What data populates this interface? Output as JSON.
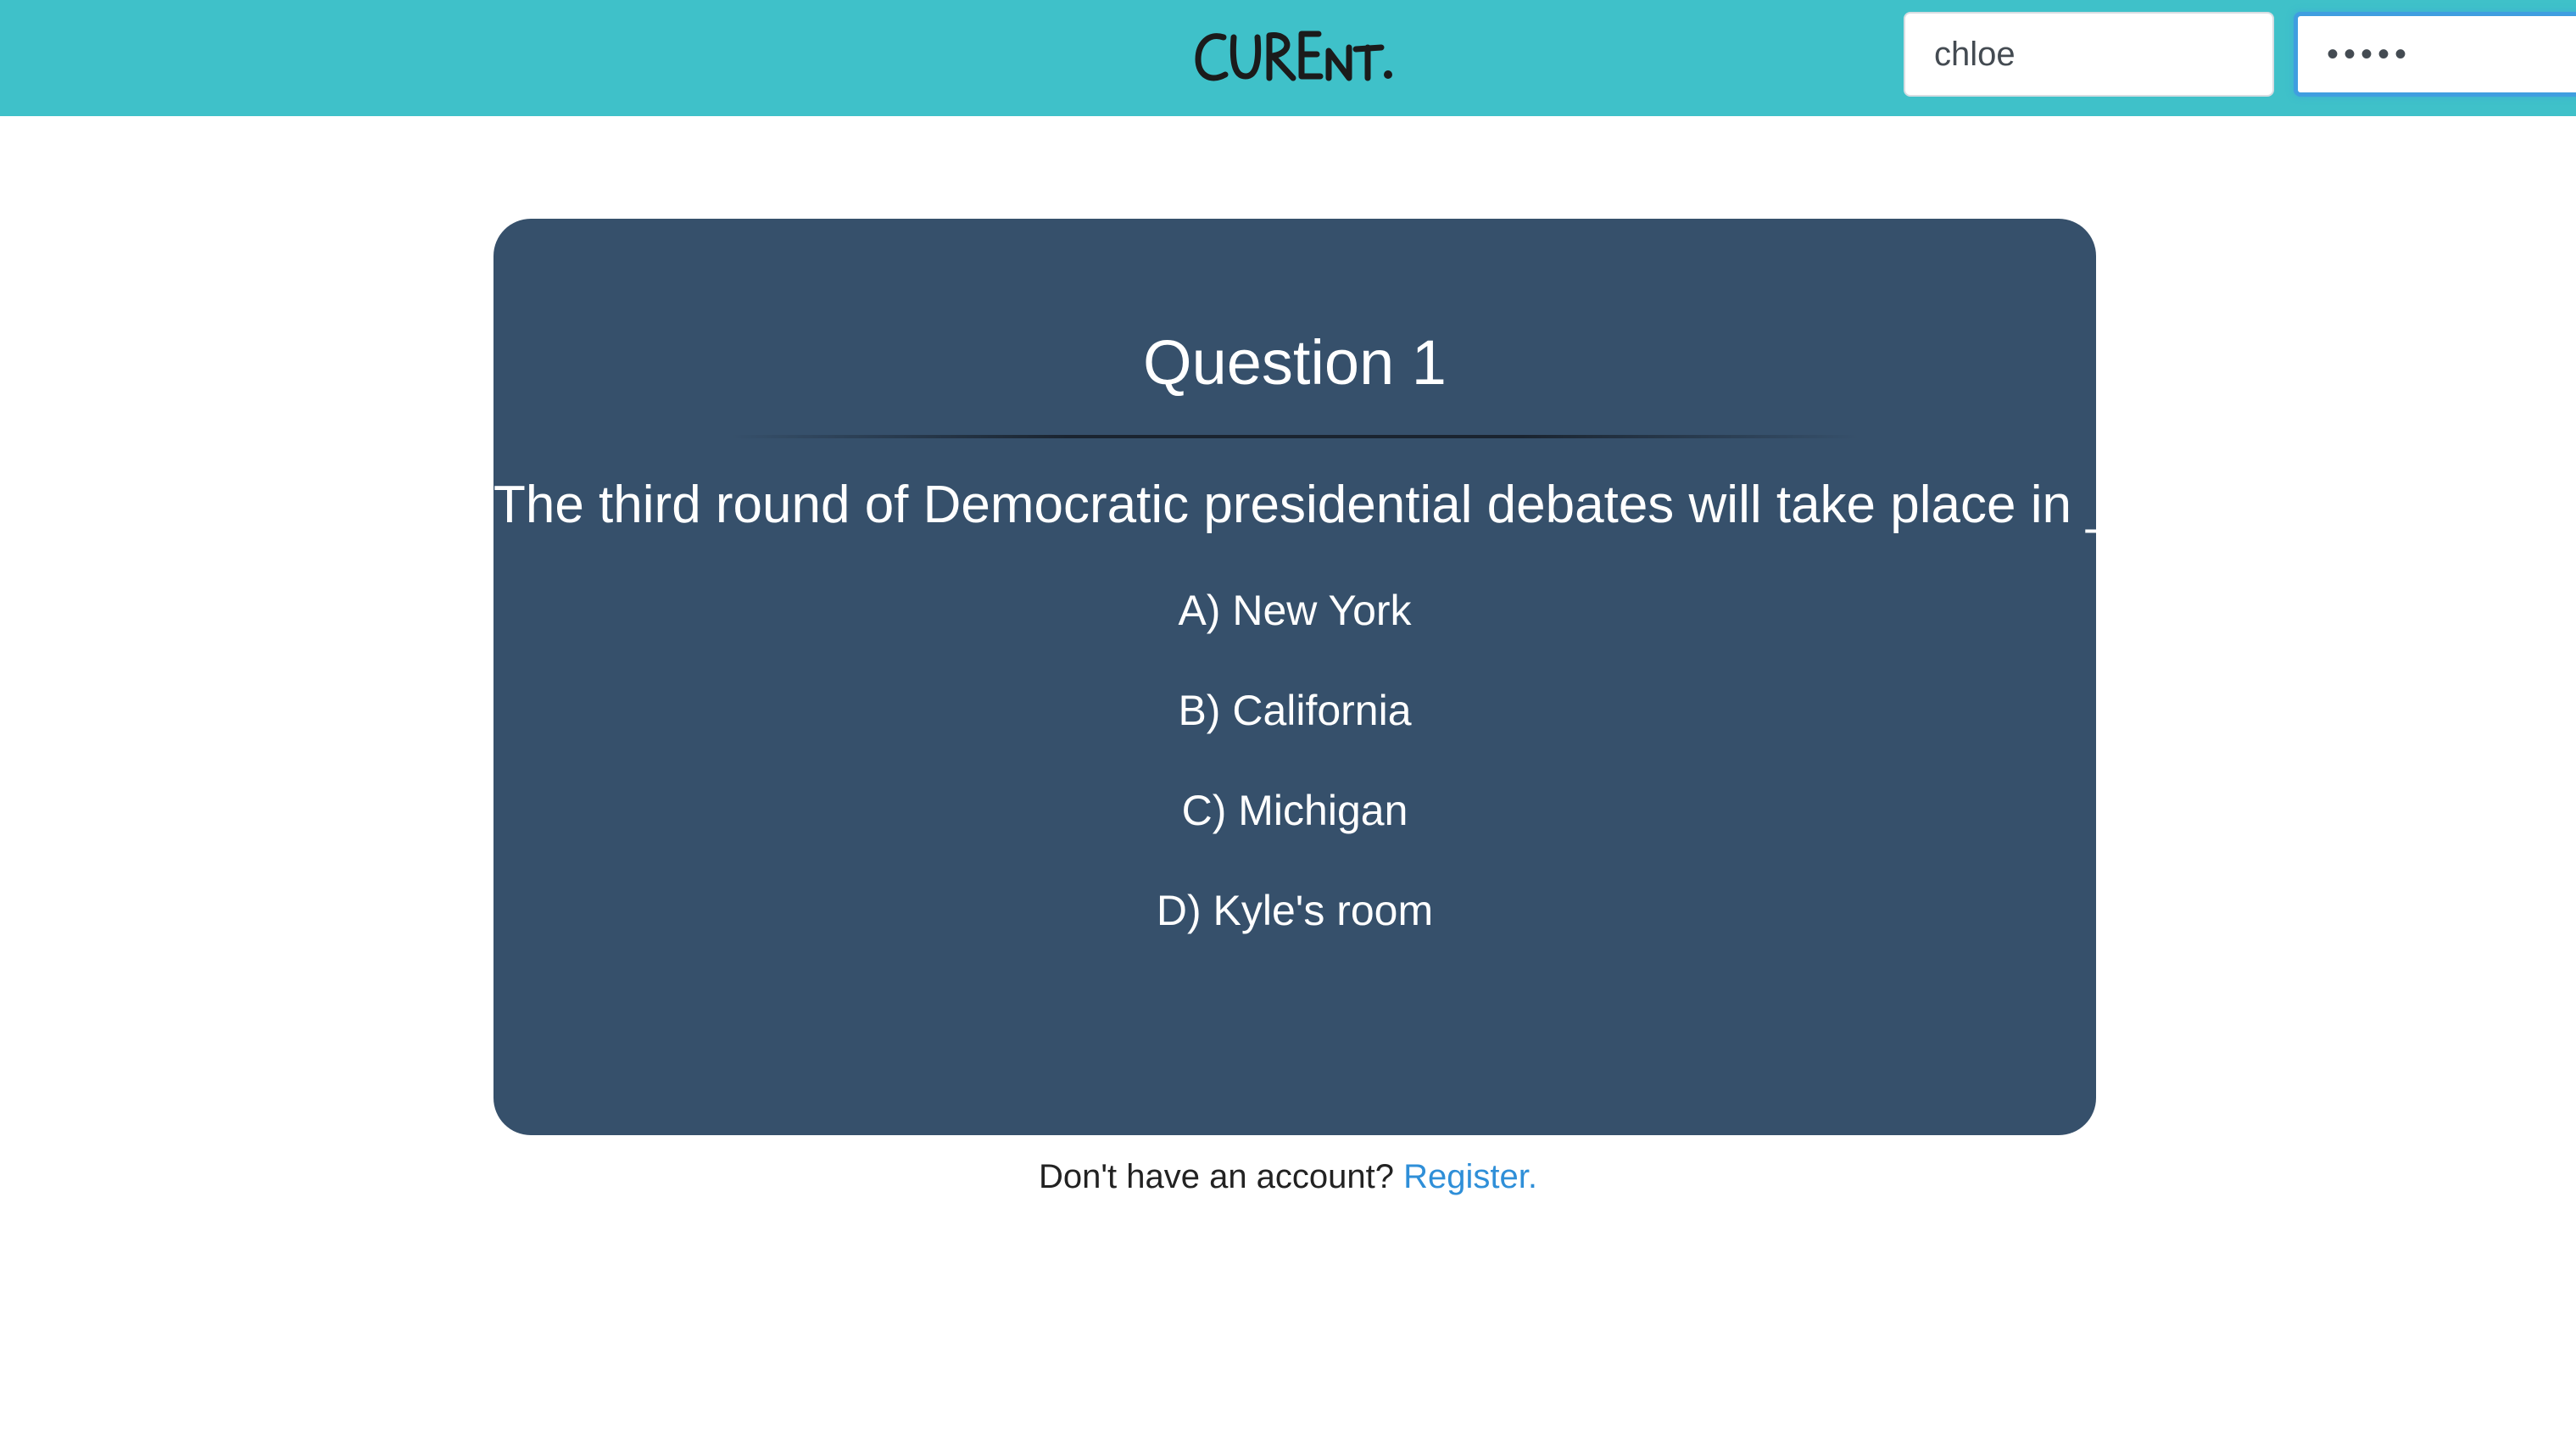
{
  "header": {
    "logo_text": "CURENT.",
    "username_value": "chloe",
    "password_value": "•••••",
    "colors": {
      "bar": "#3fc1c9",
      "focus": "#3f9ee0"
    }
  },
  "question": {
    "title": "Question 1",
    "text": "The third round of Democratic presidential debates will take place in ______?",
    "answers": [
      {
        "label": "A) New York"
      },
      {
        "label": "B) California"
      },
      {
        "label": "C) Michigan"
      },
      {
        "label": "D) Kyle's room"
      }
    ],
    "card_color": "#36506b"
  },
  "footer": {
    "prompt": "Don't have an account?",
    "register_link": "Register.",
    "link_color": "#2f8fd8"
  }
}
